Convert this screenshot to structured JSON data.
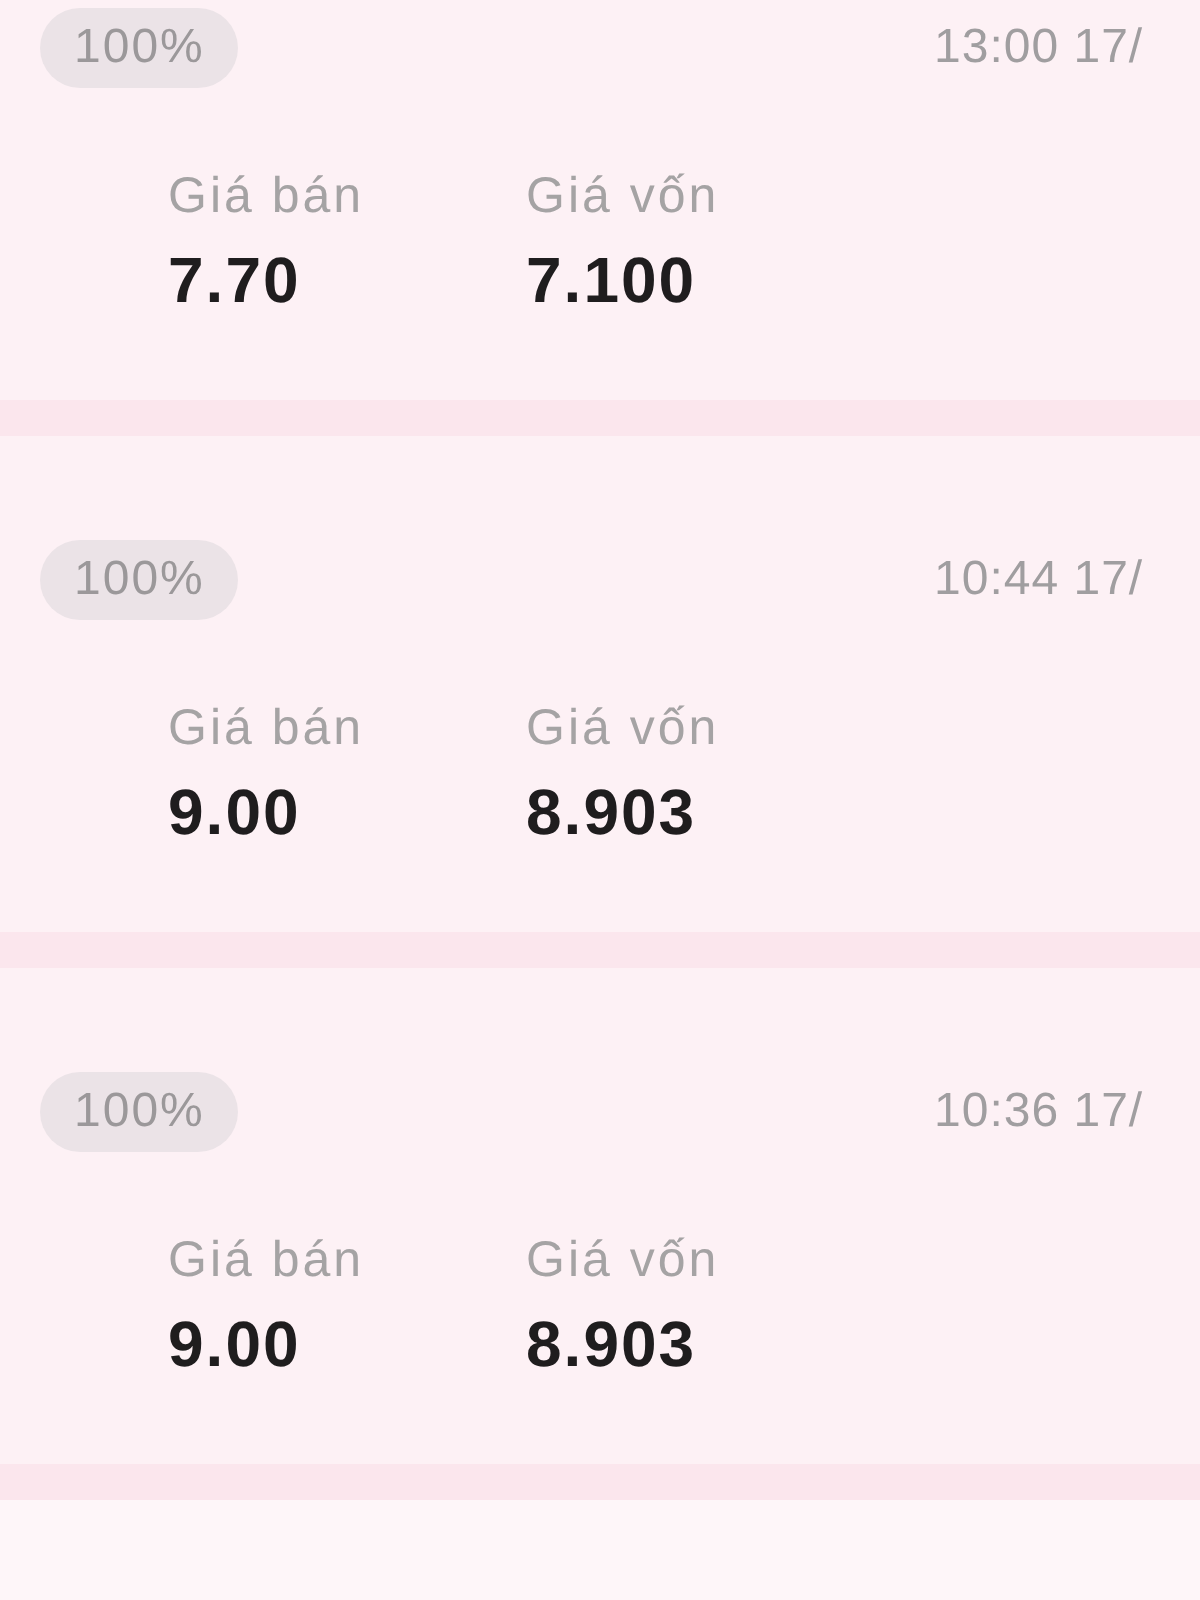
{
  "records": [
    {
      "percent": "100%",
      "time": "13:00 17/",
      "fields": [
        {
          "label": "Giá bán",
          "value": "7.70"
        },
        {
          "label": "Giá vốn",
          "value": "7.100"
        }
      ]
    },
    {
      "percent": "100%",
      "time": "10:44 17/",
      "fields": [
        {
          "label": "Giá bán",
          "value": "9.00"
        },
        {
          "label": "Giá vốn",
          "value": "8.903"
        }
      ]
    },
    {
      "percent": "100%",
      "time": "10:36 17/",
      "fields": [
        {
          "label": "Giá bán",
          "value": "9.00"
        },
        {
          "label": "Giá vốn",
          "value": "8.903"
        }
      ]
    }
  ]
}
